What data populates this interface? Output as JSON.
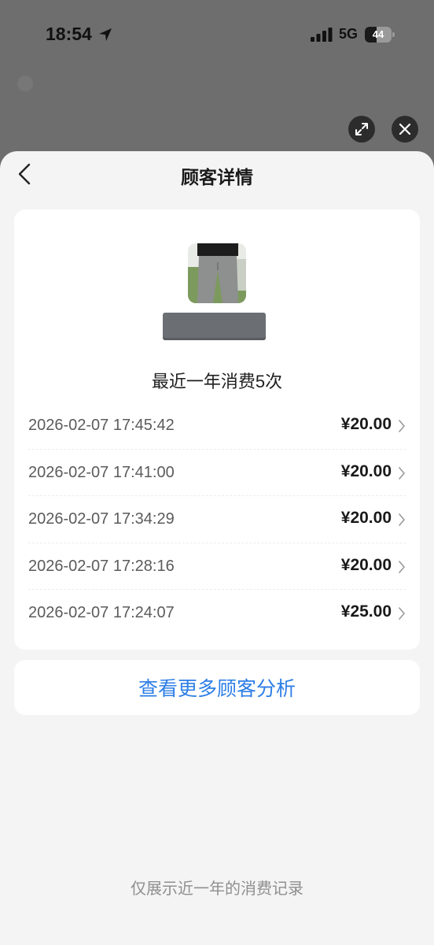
{
  "status_bar": {
    "time": "18:54",
    "network": "5G",
    "battery_percent": 44,
    "battery_label": "44"
  },
  "sheet": {
    "title": "顾客详情",
    "summary": "最近一年消费5次",
    "records": [
      {
        "time": "2026-02-07 17:45:42",
        "amount": "¥20.00"
      },
      {
        "time": "2026-02-07 17:41:00",
        "amount": "¥20.00"
      },
      {
        "time": "2026-02-07 17:34:29",
        "amount": "¥20.00"
      },
      {
        "time": "2026-02-07 17:28:16",
        "amount": "¥20.00"
      },
      {
        "time": "2026-02-07 17:24:07",
        "amount": "¥25.00"
      }
    ],
    "more_link": "查看更多顾客分析",
    "footer_note": "仅展示近一年的消费记录"
  },
  "colors": {
    "accent": "#2d7ee6",
    "overlay": "#6e6e6e",
    "sheet_bg": "#f4f4f4"
  },
  "icons": [
    "location-arrow-icon",
    "signal-bars-icon",
    "battery-icon",
    "expand-icon",
    "close-icon",
    "back-chevron-icon",
    "chevron-right-icon"
  ]
}
